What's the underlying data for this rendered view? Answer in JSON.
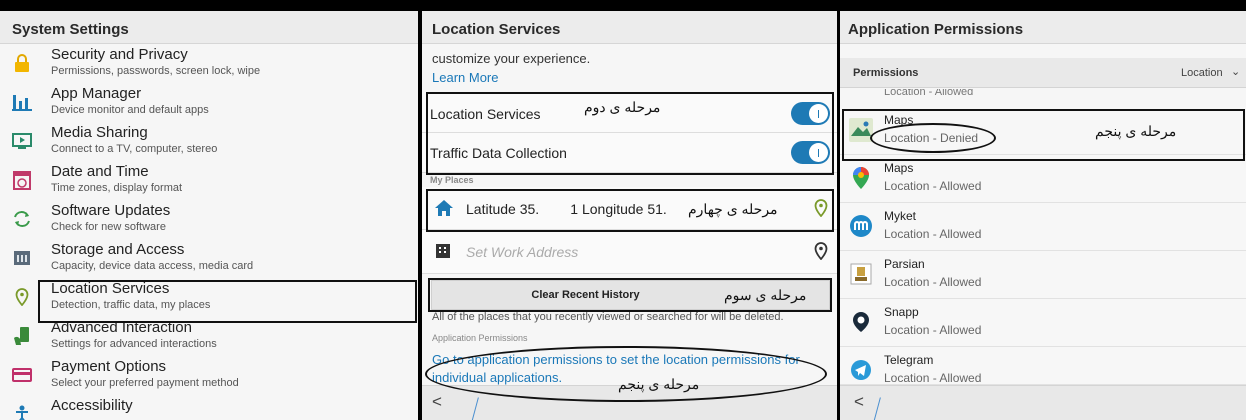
{
  "panel1": {
    "title": "System Settings",
    "items": [
      {
        "title": "Security and Privacy",
        "subtitle": "Permissions, passwords, screen lock, wipe",
        "icon": "lock-icon"
      },
      {
        "title": "App Manager",
        "subtitle": "Device monitor and default apps",
        "icon": "bar-chart-icon"
      },
      {
        "title": "Media Sharing",
        "subtitle": "Connect to a TV, computer, stereo",
        "icon": "screen-share-icon"
      },
      {
        "title": "Date and Time",
        "subtitle": "Time zones, display format",
        "icon": "calendar-clock-icon"
      },
      {
        "title": "Software Updates",
        "subtitle": "Check for new software",
        "icon": "refresh-icon"
      },
      {
        "title": "Storage and Access",
        "subtitle": "Capacity, device data access, media card",
        "icon": "storage-icon"
      },
      {
        "title": "Location Services",
        "subtitle": "Detection, traffic data, my places",
        "icon": "location-pin-icon"
      },
      {
        "title": "Advanced Interaction",
        "subtitle": "Settings for advanced interactions",
        "icon": "hand-phone-icon"
      },
      {
        "title": "Payment Options",
        "subtitle": "Select your preferred payment method",
        "icon": "credit-card-icon"
      },
      {
        "title": "Accessibility",
        "subtitle": "",
        "icon": "accessibility-icon"
      }
    ]
  },
  "panel2": {
    "title": "Location Services",
    "intro": "customize your experience.",
    "learn_more": "Learn More",
    "location_services": "Location Services",
    "traffic": "Traffic Data Collection",
    "my_places": "My Places",
    "home_address": "Latitude 35.        1 Longitude 51.",
    "work_placeholder": "Set Work Address",
    "clear_history": "Clear Recent History",
    "clear_note": "All of the places that you recently viewed or searched for will be deleted.",
    "app_permissions_label": "Application Permissions",
    "app_permissions_link": "Go to application permissions to set the location permissions for individual applications.",
    "back": "<"
  },
  "panel3": {
    "title": "Application Permissions",
    "filter_label": "Permissions",
    "filter_value": "Location",
    "partial_row": "Location - Allowed",
    "apps": [
      {
        "name": "Maps",
        "status_prefix": "Location",
        "status": " - Denied",
        "icon": "maps-bb-icon"
      },
      {
        "name": "Maps",
        "status": "Location - Allowed",
        "icon": "google-maps-icon"
      },
      {
        "name": "Myket",
        "status": "Location - Allowed",
        "icon": "myket-icon"
      },
      {
        "name": "Parsian",
        "status": "Location - Allowed",
        "icon": "parsian-icon"
      },
      {
        "name": "Snapp",
        "status": "Location - Allowed",
        "icon": "snapp-icon"
      },
      {
        "name": "Telegram",
        "status": "Location - Allowed",
        "icon": "telegram-icon"
      }
    ],
    "back": "<"
  },
  "annotations": {
    "step2": "مرحله ی دوم",
    "step3": "مرحله ی سوم",
    "step4": "مرحله ی چهارم",
    "step5": "مرحله ی پنجم"
  },
  "colors": {
    "accent": "#1e7ab5",
    "link": "#1a78b8",
    "pin": "#7a9a2a"
  }
}
